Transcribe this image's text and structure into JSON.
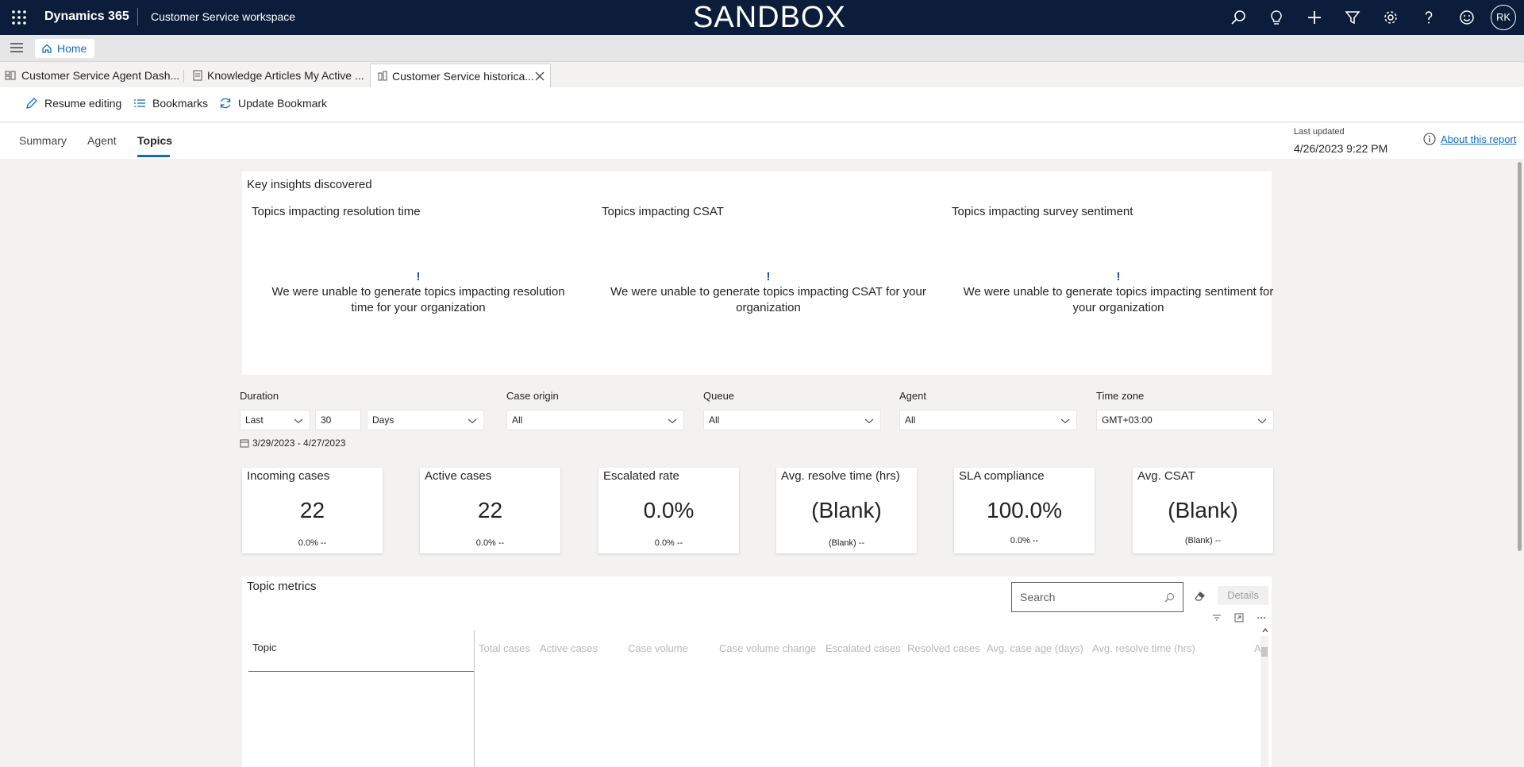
{
  "topbar": {
    "brand": "Dynamics 365",
    "app_name": "Customer Service workspace",
    "environment": "SANDBOX",
    "avatar_initials": "RK",
    "icons": [
      "search-icon",
      "lightbulb-icon",
      "plus-icon",
      "filter-icon",
      "gear-icon",
      "help-icon",
      "smiley-icon"
    ]
  },
  "homebar": {
    "home_label": "Home"
  },
  "tabs": [
    {
      "label": "Customer Service Agent Dash..."
    },
    {
      "label": "Knowledge Articles My Active ..."
    },
    {
      "label": "Customer Service historica..."
    }
  ],
  "commands": {
    "resume_editing": "Resume editing",
    "bookmarks": "Bookmarks",
    "update_bookmark": "Update Bookmark"
  },
  "report_tabs": [
    "Summary",
    "Agent",
    "Topics"
  ],
  "active_report_tab": "Topics",
  "last_updated": {
    "label": "Last updated",
    "value": "4/26/2023 9:22 PM"
  },
  "about_link": "About this report",
  "insights": {
    "title": "Key insights discovered",
    "columns": [
      {
        "heading": "Topics impacting resolution time",
        "bang": "!",
        "message": "We were unable to generate topics impacting resolution time for your organization"
      },
      {
        "heading": "Topics impacting CSAT",
        "bang": "!",
        "message": "We were unable to generate topics impacting CSAT for your organization"
      },
      {
        "heading": "Topics impacting survey sentiment",
        "bang": "!",
        "message": "We were unable to generate topics impacting sentiment for your organization"
      }
    ]
  },
  "filters": {
    "duration": {
      "label": "Duration",
      "relative": "Last",
      "count": "30",
      "unit": "Days",
      "range": "3/29/2023 - 4/27/2023"
    },
    "case_origin": {
      "label": "Case origin",
      "value": "All"
    },
    "queue": {
      "label": "Queue",
      "value": "All"
    },
    "agent": {
      "label": "Agent",
      "value": "All"
    },
    "time_zone": {
      "label": "Time zone",
      "value": "GMT+03:00"
    }
  },
  "kpis": [
    {
      "title": "Incoming cases",
      "value": "22",
      "sub": "0.0%  --"
    },
    {
      "title": "Active cases",
      "value": "22",
      "sub": "0.0%  --"
    },
    {
      "title": "Escalated rate",
      "value": "0.0%",
      "sub": "0.0%  --"
    },
    {
      "title": "Avg. resolve time (hrs)",
      "value": "(Blank)",
      "sub": "(Blank) --"
    },
    {
      "title": "SLA compliance",
      "value": "100.0%",
      "sub": "0.0%  --"
    },
    {
      "title": "Avg. CSAT",
      "value": "(Blank)",
      "sub": "(Blank)  --"
    }
  ],
  "topic_metrics": {
    "title": "Topic metrics",
    "search_placeholder": "Search",
    "details_label": "Details",
    "topic_header": "Topic",
    "columns": [
      "Total cases",
      "Active cases",
      "Case volume",
      "Case volume change",
      "Escalated cases",
      "Resolved cases",
      "Avg. case age (days)",
      "Avg. resolve time (hrs)",
      "A"
    ]
  }
}
